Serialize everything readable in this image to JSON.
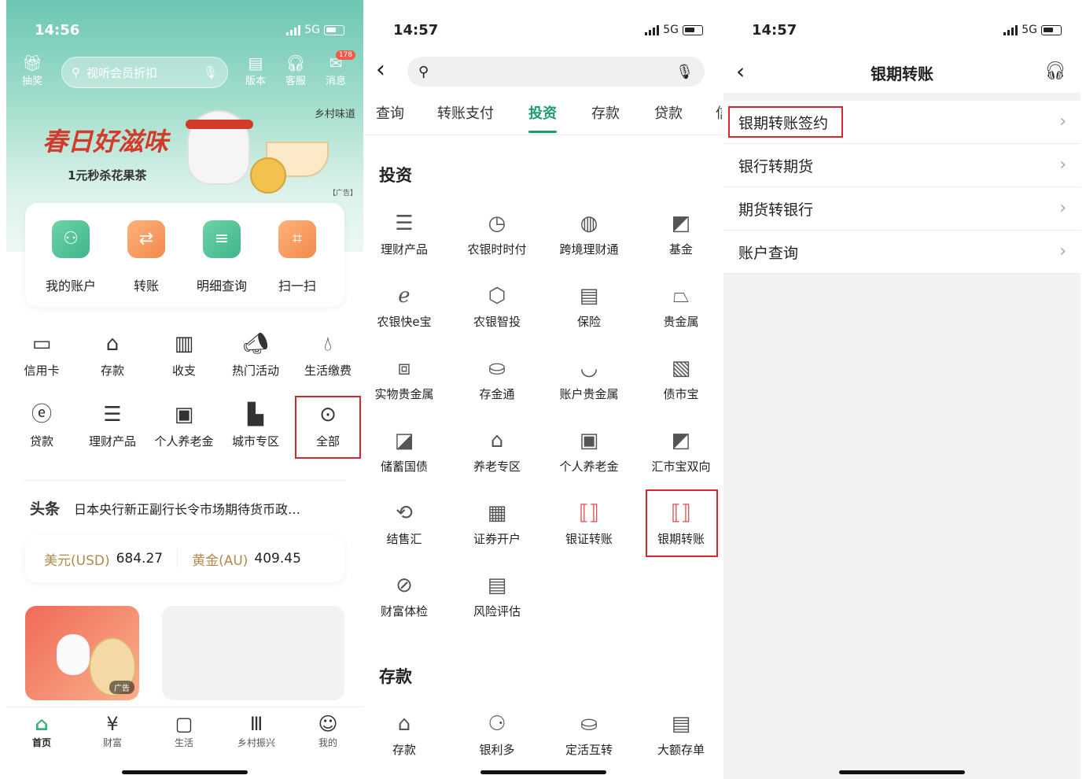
{
  "panel1": {
    "status": {
      "time": "14:56",
      "network": "5G"
    },
    "topbar": {
      "lottery": "抽奖",
      "search_placeholder": "视听会员折扣",
      "version": "版本",
      "service": "客服",
      "messages": "消息",
      "message_badge": "178"
    },
    "banner": {
      "title": "春日好滋味",
      "subtitle": "1元秒杀花果茶",
      "brand": "乡村味道",
      "ad_tag": "【广告】"
    },
    "quick": [
      {
        "label": "我的账户",
        "icon": "user-icon"
      },
      {
        "label": "转账",
        "icon": "transfer-icon"
      },
      {
        "label": "明细查询",
        "icon": "detail-icon"
      },
      {
        "label": "扫一扫",
        "icon": "scan-icon"
      }
    ],
    "grid": [
      {
        "label": "信用卡",
        "icon": "card-icon"
      },
      {
        "label": "存款",
        "icon": "deposit-icon"
      },
      {
        "label": "收支",
        "icon": "wallet-icon"
      },
      {
        "label": "热门活动",
        "icon": "megaphone-icon"
      },
      {
        "label": "生活缴费",
        "icon": "drop-icon"
      },
      {
        "label": "贷款",
        "icon": "loan-bag-icon"
      },
      {
        "label": "理财产品",
        "icon": "coins-icon"
      },
      {
        "label": "个人养老金",
        "icon": "pension-icon"
      },
      {
        "label": "城市专区",
        "icon": "city-icon"
      },
      {
        "label": "全部",
        "icon": "more-icon"
      }
    ],
    "news": {
      "tag": "头条",
      "text": "日本央行新正副行长令市场期待货币政…"
    },
    "rates": {
      "usd_label": "美元(USD)",
      "usd_value": "684.27",
      "gold_label": "黄金(AU)",
      "gold_value": "409.45"
    },
    "ad_tag": "广告",
    "tabs": [
      "首页",
      "财富",
      "生活",
      "乡村振兴",
      "我的"
    ]
  },
  "panel2": {
    "status": {
      "time": "14:57",
      "network": "5G"
    },
    "categories": [
      "查询",
      "转账支付",
      "投资",
      "存款",
      "贷款",
      "信"
    ],
    "active_category": "投资",
    "section_invest": "投资",
    "invest": [
      {
        "label": "理财产品",
        "icon": "coins-icon"
      },
      {
        "label": "农银时时付",
        "icon": "clock-yuan-icon"
      },
      {
        "label": "跨境理财通",
        "icon": "globe-icon"
      },
      {
        "label": "基金",
        "icon": "chart-up-icon"
      },
      {
        "label": "农银快e宝",
        "icon": "e-chart-icon"
      },
      {
        "label": "农银智投",
        "icon": "hexagon-chart-icon"
      },
      {
        "label": "保险",
        "icon": "shield-doc-icon"
      },
      {
        "label": "贵金属",
        "icon": "gold-bar-icon"
      },
      {
        "label": "实物贵金属",
        "icon": "bars-stack-icon"
      },
      {
        "label": "存金通",
        "icon": "gold-basket-icon"
      },
      {
        "label": "账户贵金属",
        "icon": "gold-bowl-icon"
      },
      {
        "label": "债市宝",
        "icon": "bond-doc-icon"
      },
      {
        "label": "储蓄国债",
        "icon": "bond-chart-icon"
      },
      {
        "label": "养老专区",
        "icon": "elder-home-icon"
      },
      {
        "label": "个人养老金",
        "icon": "pension-icon"
      },
      {
        "label": "汇市宝双向",
        "icon": "fx-chart-icon"
      },
      {
        "label": "结售汇",
        "icon": "exchange-icon"
      },
      {
        "label": "证券开户",
        "icon": "securities-icon"
      },
      {
        "label": "银证转账",
        "icon": "bank-securities-icon"
      },
      {
        "label": "银期转账",
        "icon": "bank-futures-icon"
      },
      {
        "label": "财富体检",
        "icon": "wealth-check-icon"
      },
      {
        "label": "风险评估",
        "icon": "risk-doc-icon"
      }
    ],
    "section_deposit": "存款",
    "deposit": [
      {
        "label": "存款",
        "icon": "deposit-icon"
      },
      {
        "label": "银利多",
        "icon": "interest-icon"
      },
      {
        "label": "定活互转",
        "icon": "fixed-icon"
      },
      {
        "label": "大额存单",
        "icon": "cd-doc-icon"
      }
    ]
  },
  "panel3": {
    "status": {
      "time": "14:57",
      "network": "5G"
    },
    "title": "银期转账",
    "rows": [
      "银期转账签约",
      "银行转期货",
      "期货转银行",
      "账户查询"
    ]
  }
}
